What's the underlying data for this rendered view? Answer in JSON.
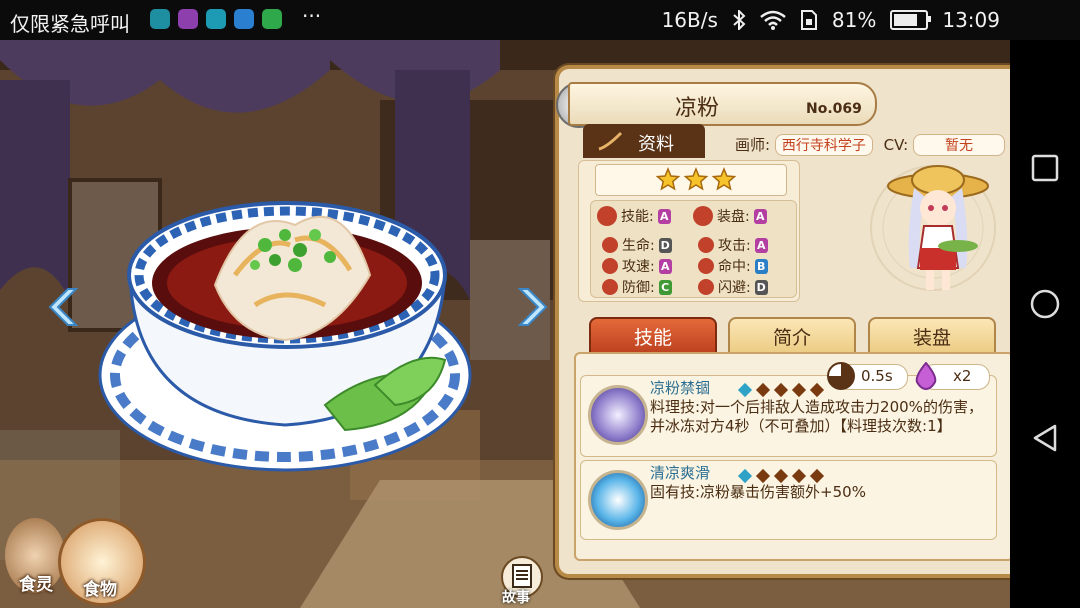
{
  "status_bar": {
    "carrier": "仅限紧急呼叫",
    "net_speed": "16B/s",
    "battery_pct": "81%",
    "battery_level": 0.81,
    "time": "13:09",
    "app_icons": [
      "moon-app-icon",
      "gallery-app-icon",
      "shield-app-icon",
      "store-app-icon",
      "grid-app-icon"
    ],
    "overflow": "···"
  },
  "food": {
    "name": "凉粉",
    "number": "No.069",
    "star_count": 3
  },
  "tabs": {
    "info": "资料",
    "skill": "技能",
    "intro": "简介",
    "plating": "装盘"
  },
  "credits": {
    "artist_label": "画师:",
    "artist": "西行寺科学子",
    "cv_label": "CV:",
    "cv": "暂无"
  },
  "stats": {
    "skill": {
      "label": "技能:",
      "grade": "A"
    },
    "plating": {
      "label": "装盘:",
      "grade": "A"
    },
    "hp": {
      "label": "生命:",
      "grade": "D"
    },
    "attack": {
      "label": "攻击:",
      "grade": "A"
    },
    "attack_speed": {
      "label": "攻速:",
      "grade": "A"
    },
    "accuracy": {
      "label": "命中:",
      "grade": "B"
    },
    "defense": {
      "label": "防御:",
      "grade": "C"
    },
    "evasion": {
      "label": "闪避:",
      "grade": "D"
    }
  },
  "skills": [
    {
      "name": "凉粉禁锢",
      "cooldown": "0.5s",
      "energy": "x2",
      "description": "料理技:对一个后排敌人造成攻击力200%的伤害，并冰冻对方4秒（不可叠加）【料理技次数:1】"
    },
    {
      "name": "清凉爽滑",
      "description": "固有技:凉粉暴击伤害额外+50%"
    }
  ],
  "bottom": {
    "spirit": "食灵",
    "food": "食物",
    "story": "故事"
  },
  "colors": {
    "grade_A": "#b43fa3",
    "grade_B": "#2b7fc6",
    "grade_C": "#3f9a36",
    "grade_D": "#555555",
    "panel_bg": "#efe3cc",
    "frame": "#b88a48",
    "skill_name": "#2c6f93",
    "credit_text": "#c4421f"
  }
}
